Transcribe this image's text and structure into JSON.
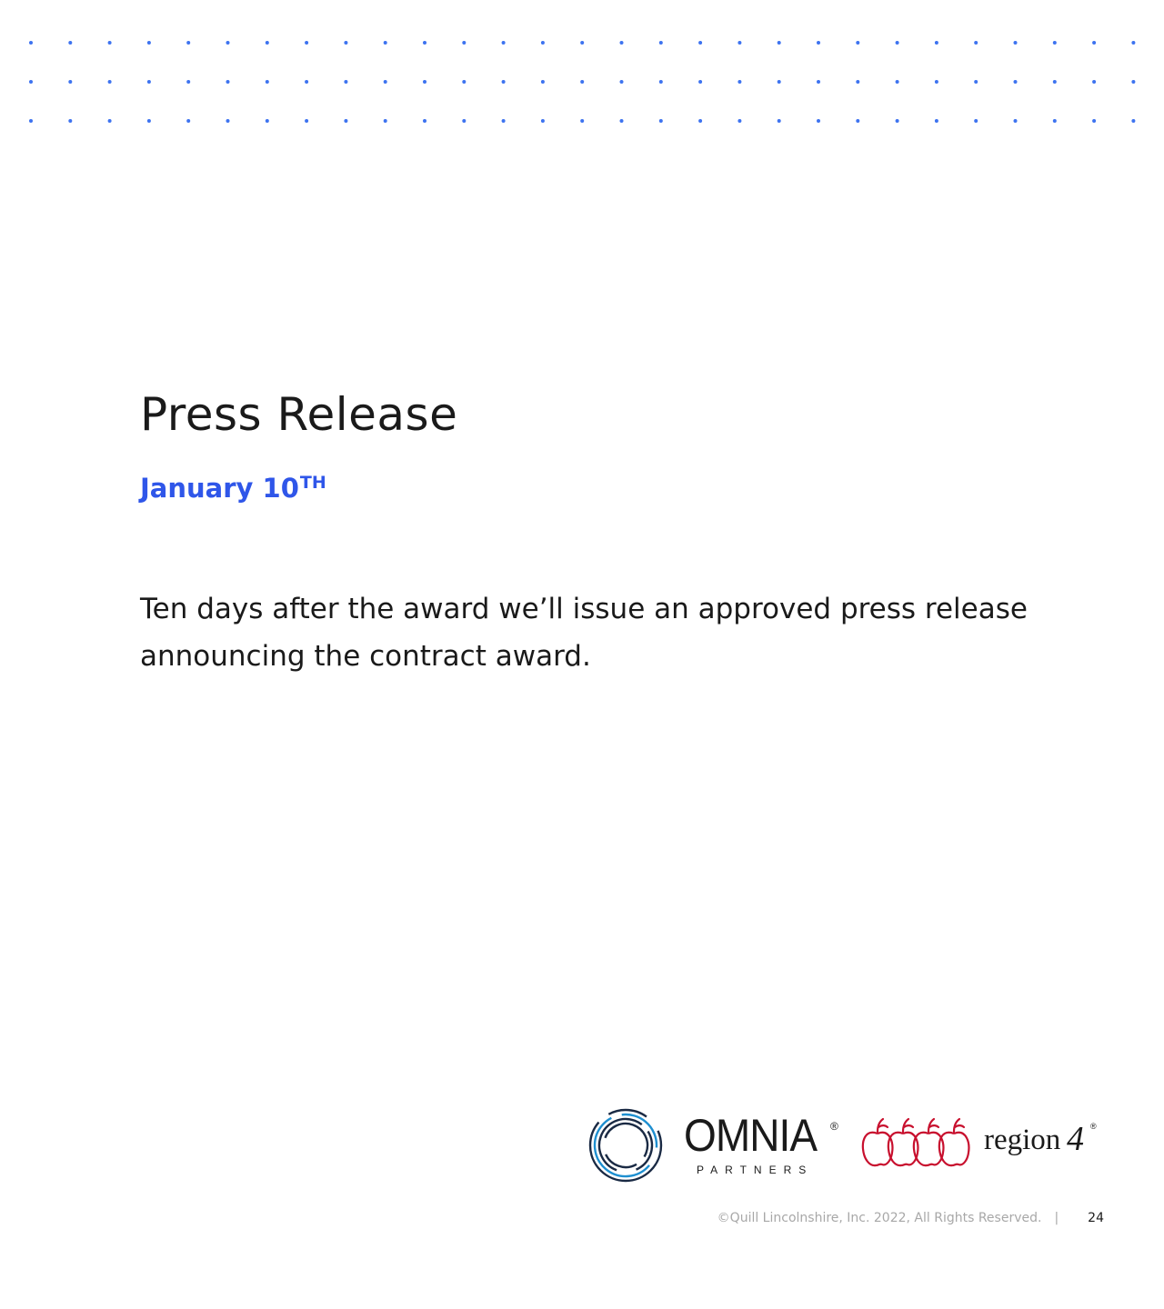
{
  "title": "Press Release",
  "date": {
    "main": "January 10",
    "suffix": "TH"
  },
  "body": "Ten days after the award we’ll issue an approved press release announcing the contract award.",
  "logos": {
    "omnia": {
      "name": "OMNIA",
      "reg": "®",
      "sub": "PARTNERS",
      "icon": "omnia-ring-logo"
    },
    "region4": {
      "name": "region",
      "number": "4",
      "reg": "®",
      "icon": "apples-logo"
    }
  },
  "footer": {
    "copyright": "©Quill Lincolnshire, Inc. 2022, All Rights Reserved.",
    "separator": "|",
    "page_number": "24"
  },
  "colors": {
    "accent": "#2f56e9",
    "dots": "#3d73f0",
    "apple_red": "#c8102e",
    "ring_blue": "#1e8fd0"
  }
}
